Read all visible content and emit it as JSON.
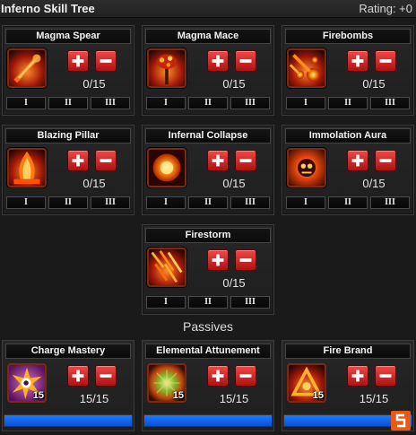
{
  "header": {
    "title": "Inferno Skill Tree",
    "rating": "Rating: +0"
  },
  "skills": [
    {
      "name": "Magma Spear",
      "points": "0/15",
      "icon": "magma-spear-icon"
    },
    {
      "name": "Magma Mace",
      "points": "0/15",
      "icon": "magma-mace-icon"
    },
    {
      "name": "Firebombs",
      "points": "0/15",
      "icon": "firebombs-icon"
    },
    {
      "name": "Blazing Pillar",
      "points": "0/15",
      "icon": "blazing-pillar-icon"
    },
    {
      "name": "Infernal Collapse",
      "points": "0/15",
      "icon": "infernal-collapse-icon"
    },
    {
      "name": "Immolation Aura",
      "points": "0/15",
      "icon": "immolation-aura-icon"
    },
    {
      "name": "Firestorm",
      "points": "0/15",
      "icon": "firestorm-icon"
    }
  ],
  "tiers": [
    "I",
    "II",
    "III"
  ],
  "passives_title": "Passives",
  "passives": [
    {
      "name": "Charge Mastery",
      "points": "15/15",
      "rank": "15",
      "progress": 1.0,
      "icon": "charge-mastery-icon"
    },
    {
      "name": "Elemental Attunement",
      "points": "15/15",
      "rank": "15",
      "progress": 1.0,
      "icon": "elemental-attunement-icon"
    },
    {
      "name": "Fire Brand",
      "points": "15/15",
      "rank": "15",
      "progress": 1.0,
      "icon": "fire-brand-icon"
    }
  ],
  "colors": {
    "button_red": "#d42020",
    "progress_blue": "#1e7bff",
    "icon_border": "#7a2a10",
    "logo_orange": "#e85a14"
  }
}
